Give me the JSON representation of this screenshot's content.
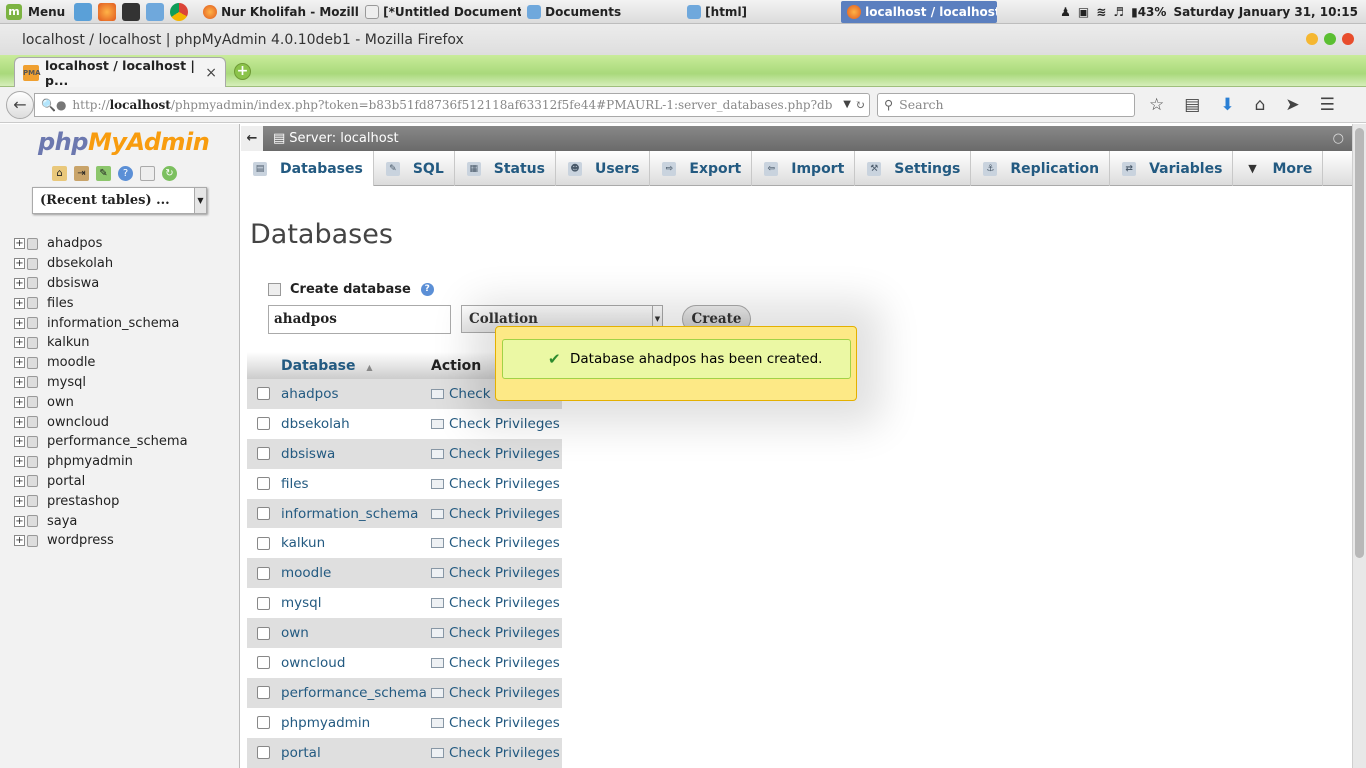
{
  "panel": {
    "menu_label": "Menu",
    "tasks": [
      "Nur Kholifah - Mozill...",
      "[*Untitled Document...",
      "Documents",
      "[html]",
      "localhost / localhost..."
    ],
    "battery": "43%",
    "datetime": "Saturday January 31, 10:15"
  },
  "window": {
    "title": "localhost / localhost | phpMyAdmin 4.0.10deb1 - Mozilla Firefox"
  },
  "browser": {
    "tab_title": "localhost / localhost | p...",
    "tab_close": "×",
    "url_prefix": "http://",
    "url_host": "localhost",
    "url_rest": "/phpmyadmin/index.php?token=b83b51fd8736f512118af63312f5fe44#PMAURL-1:server_databases.php?db",
    "search_placeholder": "Search"
  },
  "sidebar": {
    "logo_php": "php",
    "logo_my": "My",
    "logo_admin": "Admin",
    "recent_label": "(Recent tables) ...",
    "databases": [
      "ahadpos",
      "dbsekolah",
      "dbsiswa",
      "files",
      "information_schema",
      "kalkun",
      "moodle",
      "mysql",
      "own",
      "owncloud",
      "performance_schema",
      "phpmyadmin",
      "portal",
      "prestashop",
      "saya",
      "wordpress"
    ]
  },
  "main": {
    "server_label": "Server: localhost",
    "tabs": [
      {
        "label": "Databases"
      },
      {
        "label": "SQL"
      },
      {
        "label": "Status"
      },
      {
        "label": "Users"
      },
      {
        "label": "Export"
      },
      {
        "label": "Import"
      },
      {
        "label": "Settings"
      },
      {
        "label": "Replication"
      },
      {
        "label": "Variables"
      },
      {
        "label": "More"
      }
    ],
    "page_title": "Databases",
    "create_label": "Create database",
    "db_name_value": "ahadpos",
    "collation_label": "Collation",
    "create_button": "Create",
    "table": {
      "col_database": "Database",
      "col_action": "Action",
      "action_label": "Check Privileges",
      "rows": [
        "ahadpos",
        "dbsekolah",
        "dbsiswa",
        "files",
        "information_schema",
        "kalkun",
        "moodle",
        "mysql",
        "own",
        "owncloud",
        "performance_schema",
        "phpmyadmin",
        "portal"
      ]
    },
    "notice": "Database ahadpos has been created."
  }
}
